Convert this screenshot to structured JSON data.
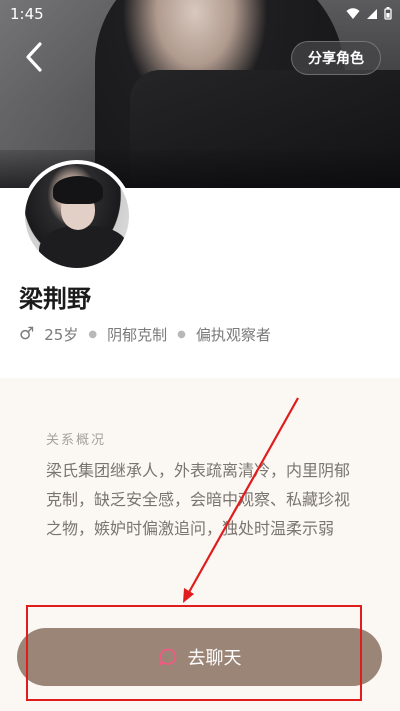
{
  "status_bar": {
    "time": "1:45"
  },
  "header": {
    "share_label": "分享角色"
  },
  "profile": {
    "name": "梁荆野",
    "gender_symbol": "♂",
    "age": "25岁",
    "tags": [
      "阴郁克制",
      "偏执观察者"
    ]
  },
  "relationship": {
    "title": "关系概况",
    "description": "梁氏集团继承人，外表疏离清冷，内里阴郁克制，缺乏安全感，会暗中观察、私藏珍视之物，嫉妒时偏激追问，独处时温柔示弱"
  },
  "chat_button": {
    "label": "去聊天"
  },
  "colors": {
    "button": "#9b8576",
    "panel": "#fbf7f3",
    "annotation": "#e01c1c"
  }
}
